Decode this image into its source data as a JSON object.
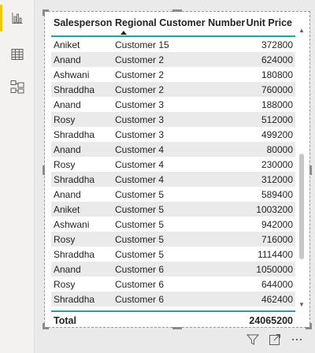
{
  "nav": {
    "items": [
      {
        "name": "report-view-icon",
        "active": true
      },
      {
        "name": "data-view-icon",
        "active": false
      },
      {
        "name": "model-view-icon",
        "active": false
      }
    ]
  },
  "table": {
    "columns": [
      "Salesperson",
      "Regional Customer Number",
      "Unit Price"
    ],
    "sorted_column": "Regional Customer Number",
    "sort_direction": "ascending",
    "rows": [
      [
        "Aniket",
        "Customer 15",
        "372800"
      ],
      [
        "Anand",
        "Customer 2",
        "624000"
      ],
      [
        "Ashwani",
        "Customer 2",
        "180800"
      ],
      [
        "Shraddha",
        "Customer 2",
        "760000"
      ],
      [
        "Anand",
        "Customer 3",
        "188000"
      ],
      [
        "Rosy",
        "Customer 3",
        "512000"
      ],
      [
        "Shraddha",
        "Customer 3",
        "499200"
      ],
      [
        "Anand",
        "Customer 4",
        "80000"
      ],
      [
        "Rosy",
        "Customer 4",
        "230000"
      ],
      [
        "Shraddha",
        "Customer 4",
        "312000"
      ],
      [
        "Anand",
        "Customer 5",
        "589400"
      ],
      [
        "Aniket",
        "Customer 5",
        "1003200"
      ],
      [
        "Ashwani",
        "Customer 5",
        "942000"
      ],
      [
        "Rosy",
        "Customer 5",
        "716000"
      ],
      [
        "Shraddha",
        "Customer 5",
        "1114400"
      ],
      [
        "Anand",
        "Customer 6",
        "1050000"
      ],
      [
        "Rosy",
        "Customer 6",
        "644000"
      ],
      [
        "Shraddha",
        "Customer 6",
        "462400"
      ]
    ],
    "total_label": "Total",
    "total_value": "24065200",
    "alt_row_color": "#eaeaea",
    "accent_color": "#2aa198"
  },
  "visual_footer": {
    "icons": [
      "filter-icon",
      "focus-mode-icon",
      "more-options-icon"
    ]
  }
}
